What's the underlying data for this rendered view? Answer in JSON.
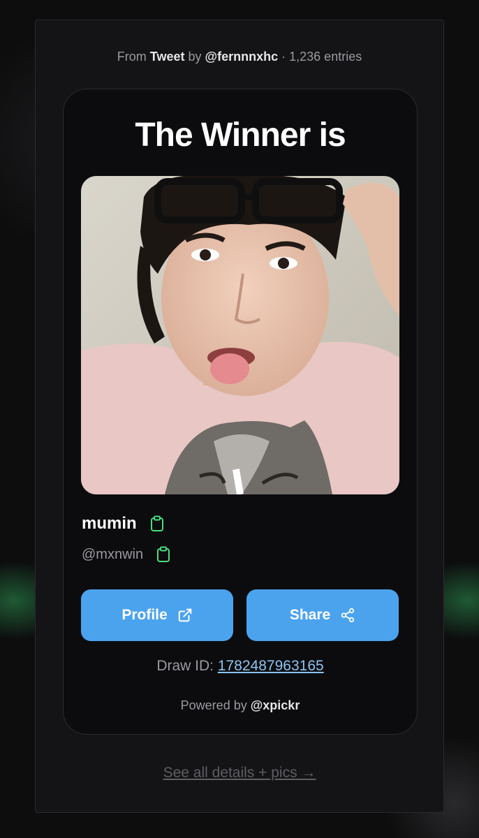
{
  "source": {
    "prefix": "From",
    "platform": "Tweet",
    "by": "by",
    "author": "@fernnnxhc",
    "separator": "·",
    "entries": "1,236 entries"
  },
  "card": {
    "title": "The Winner is",
    "winner_name": "mumin",
    "winner_handle": "@mxnwin",
    "copy_icon": "clipboard-icon"
  },
  "buttons": {
    "profile_label": "Profile",
    "profile_icon": "external-link-icon",
    "share_label": "Share",
    "share_icon": "share-icon"
  },
  "draw": {
    "label": "Draw ID:",
    "id": "1782487963165"
  },
  "powered": {
    "prefix": "Powered by",
    "brand": "@xpickr"
  },
  "footer_link": "See all details + pics →",
  "colors": {
    "accent": "#4ba3ee",
    "copy_icon": "#4ade80",
    "link": "#8cc4f2",
    "card_bg": "#0c0c0e"
  }
}
